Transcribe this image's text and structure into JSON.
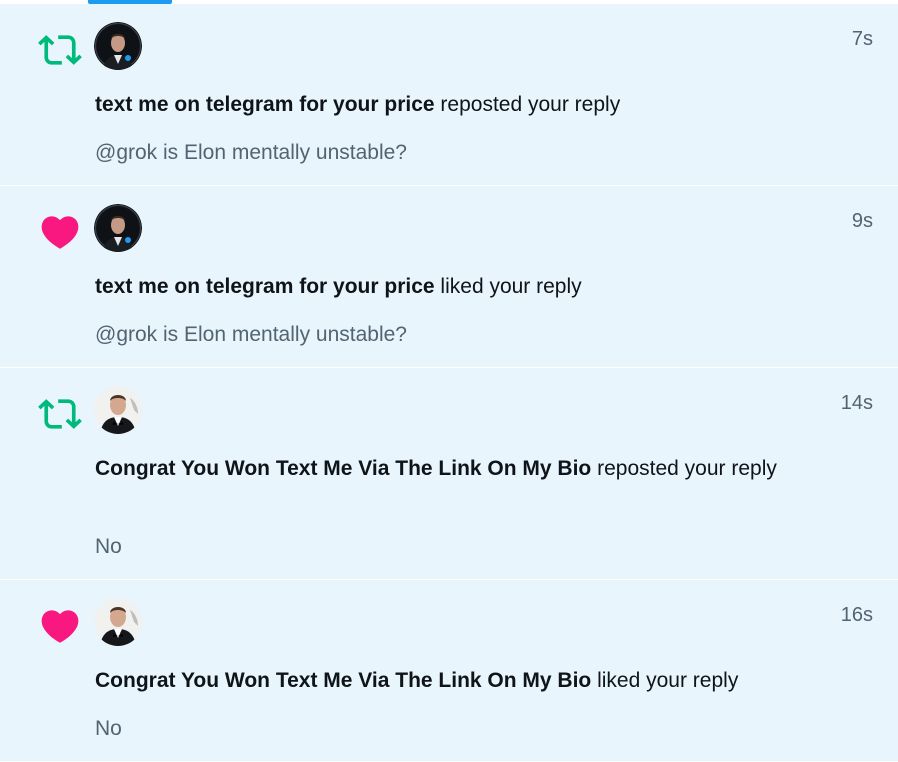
{
  "notifications": [
    {
      "type": "repost",
      "icon": "repost-icon",
      "avatar": "dark-avatar",
      "time": "7s",
      "actor": "text me on telegram for your price",
      "action": " reposted your reply",
      "quote": "@grok is Elon mentally unstable?"
    },
    {
      "type": "like",
      "icon": "heart-icon",
      "avatar": "dark-avatar",
      "time": "9s",
      "actor": "text me on telegram for your price",
      "action": " liked your reply",
      "quote": "@grok is Elon mentally unstable?"
    },
    {
      "type": "repost",
      "icon": "repost-icon",
      "avatar": "light-avatar",
      "time": "14s",
      "actor": "Congrat You Won Text Me Via The Link On My Bio",
      "action": " reposted your reply",
      "quote": "No"
    },
    {
      "type": "like",
      "icon": "heart-icon",
      "avatar": "light-avatar",
      "time": "16s",
      "actor": "Congrat You Won Text Me Via The Link On My Bio",
      "action": " liked your reply",
      "quote": "No"
    }
  ],
  "colors": {
    "repost": "#00ba7c",
    "like": "#f91880",
    "accent": "#1d9bf0",
    "row_bg": "#e8f5fd",
    "text": "#0f1419",
    "secondary": "#536471"
  }
}
